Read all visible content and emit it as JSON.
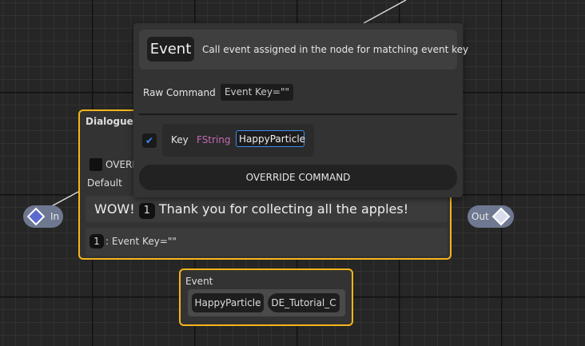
{
  "dialogue_node": {
    "title": "DialogueNo",
    "override_label": "OVERRIDE",
    "default_label": "Default",
    "text_prefix": "WOW!",
    "text_badge": "1",
    "text_value": "Thank you for collecting all the apples!",
    "command_badge": "1",
    "command_text": ": Event Key=\"\""
  },
  "pins": {
    "in_label": "In",
    "out_label": "Out"
  },
  "event_node": {
    "title": "Event",
    "chips": [
      "HappyParticle",
      "DE_Tutorial_C"
    ]
  },
  "popup": {
    "badge": "Event",
    "description": "Call event assigned in the node for matching event key",
    "raw_command_label": "Raw Command",
    "raw_command_value": "Event Key=\"\"",
    "key_checked": true,
    "key_label": "Key",
    "key_type": "FString",
    "key_value": "HappyParticle",
    "override_button": "OVERRIDE COMMAND"
  },
  "colors": {
    "node_border": "#f5b51b",
    "pin_bg": "#6e7890",
    "type_fstring": "#c56ab2",
    "focus_border": "#3a8cf0"
  }
}
